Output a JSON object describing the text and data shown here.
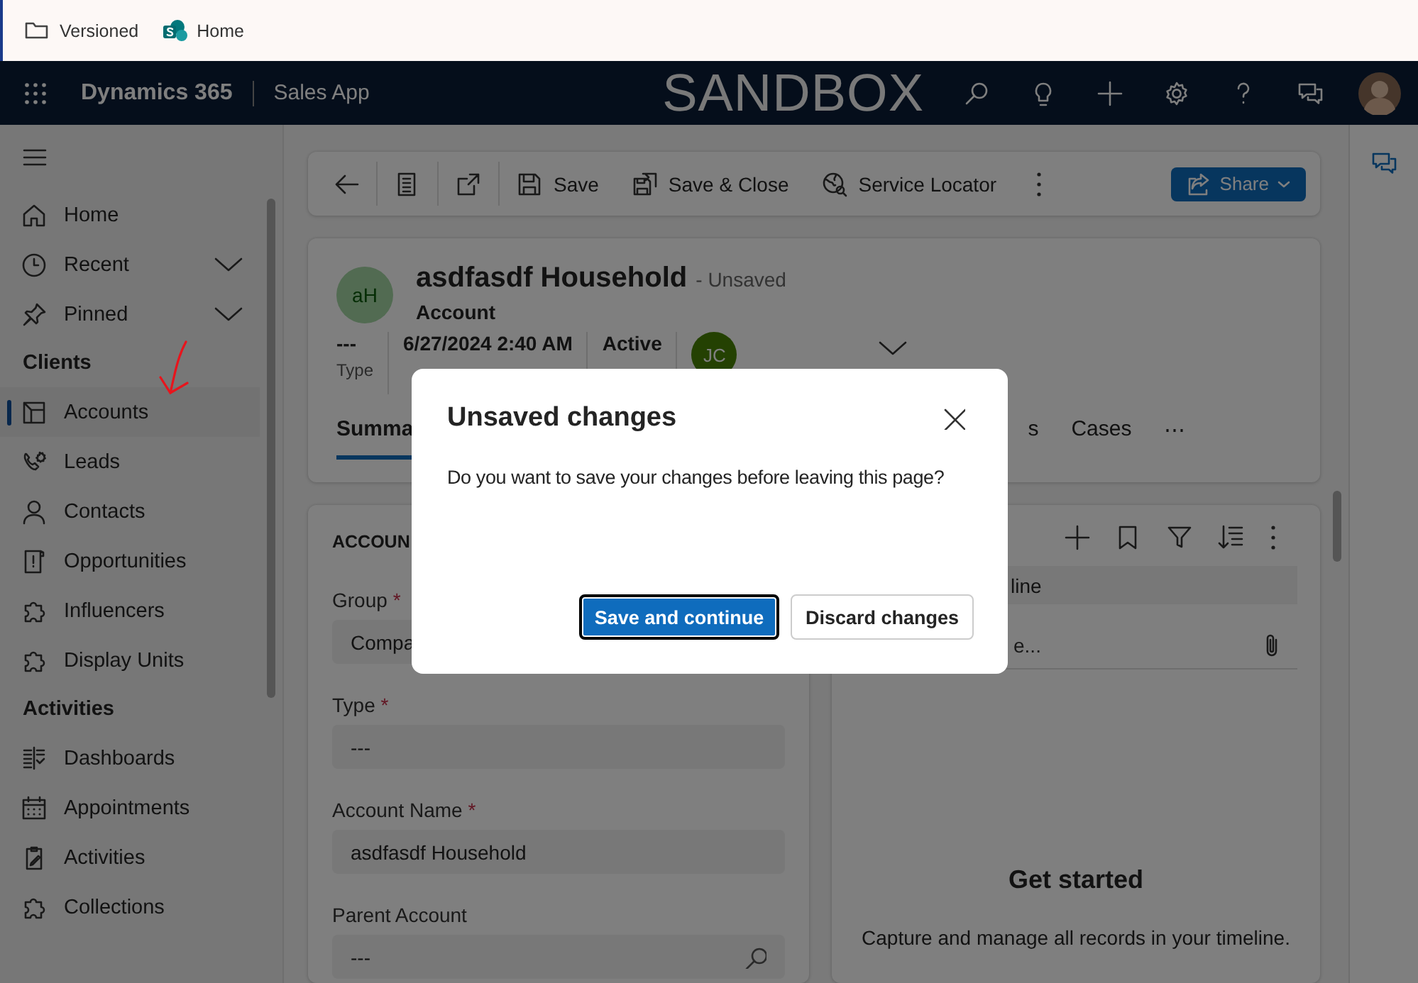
{
  "bookmarks": [
    {
      "label": "Versioned",
      "kind": "folder"
    },
    {
      "label": "Home",
      "kind": "site"
    }
  ],
  "app_bar": {
    "product": "Dynamics 365",
    "app": "Sales App",
    "environment": "SANDBOX"
  },
  "sidebar": {
    "items": [
      {
        "label": "Home",
        "expandable": false,
        "selected": false
      },
      {
        "label": "Recent",
        "expandable": true,
        "selected": false
      },
      {
        "label": "Pinned",
        "expandable": true,
        "selected": false
      }
    ],
    "sections": [
      {
        "title": "Clients",
        "items": [
          {
            "label": "Accounts",
            "selected": true
          },
          {
            "label": "Leads",
            "selected": false
          },
          {
            "label": "Contacts",
            "selected": false
          },
          {
            "label": "Opportunities",
            "selected": false
          },
          {
            "label": "Influencers",
            "selected": false
          },
          {
            "label": "Display Units",
            "selected": false
          }
        ]
      },
      {
        "title": "Activities",
        "items": [
          {
            "label": "Dashboards",
            "selected": false
          },
          {
            "label": "Appointments",
            "selected": false
          },
          {
            "label": "Activities",
            "selected": false
          },
          {
            "label": "Collections",
            "selected": false
          }
        ]
      }
    ]
  },
  "command_bar": {
    "commands": [
      {
        "label": "Save"
      },
      {
        "label": "Save & Close"
      },
      {
        "label": "Service Locator"
      }
    ],
    "share": "Share"
  },
  "record": {
    "initials": "aH",
    "title": "asdfasdf Household",
    "status": "- Unsaved",
    "entity": "Account",
    "fields": [
      {
        "value": "---",
        "label": "Type"
      },
      {
        "value": "6/27/2024 2:40 AM"
      },
      {
        "value": "Active"
      }
    ],
    "owner_initials": "JC",
    "tabs": [
      {
        "label": "Summa",
        "selected": true
      },
      {
        "label": "s",
        "selected": false
      },
      {
        "label": "Cases",
        "selected": false
      }
    ],
    "more_tabs": "⋯"
  },
  "form": {
    "section_title": "ACCOUN",
    "fields": [
      {
        "label": "Group",
        "marker": "*",
        "value": "Compa"
      },
      {
        "label": "Type",
        "marker": "*",
        "value": "---"
      },
      {
        "label": "Account Name",
        "marker": "*",
        "value": "asdfasdf Household"
      },
      {
        "label": "Parent Account",
        "value": "---",
        "kind": "lookup"
      }
    ]
  },
  "timeline": {
    "search": "line",
    "note": "e...",
    "empty_title": "Get started",
    "empty_text": "Capture and manage all records in your timeline."
  },
  "dialog": {
    "title": "Unsaved changes",
    "message": "Do you want to save your changes before leaving this page?",
    "buttons": [
      {
        "label": "Save and continue",
        "kind": "primary"
      },
      {
        "label": "Discard changes",
        "kind": "secondary"
      }
    ]
  }
}
